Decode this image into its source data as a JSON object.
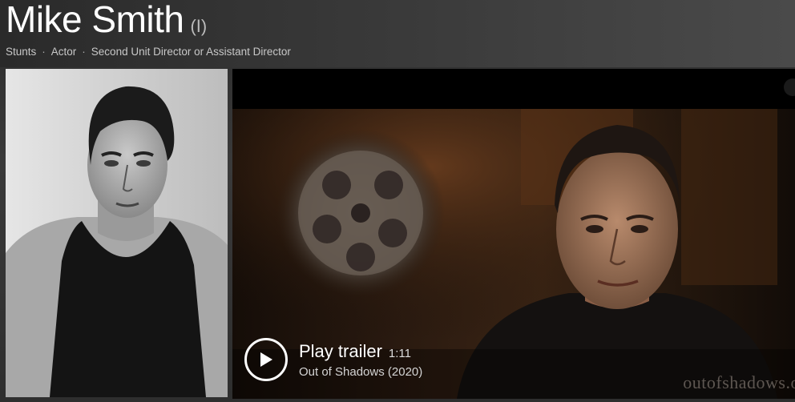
{
  "header": {
    "name": "Mike Smith",
    "suffix": "(I)",
    "roles": [
      "Stunts",
      "Actor",
      "Second Unit Director or Assistant Director"
    ],
    "separator": "·"
  },
  "trailer": {
    "play_label": "Play trailer",
    "duration": "1:11",
    "title": "Out of Shadows (2020)",
    "watermark": "outofshadows.o"
  },
  "icons": {
    "play": "play-icon"
  }
}
